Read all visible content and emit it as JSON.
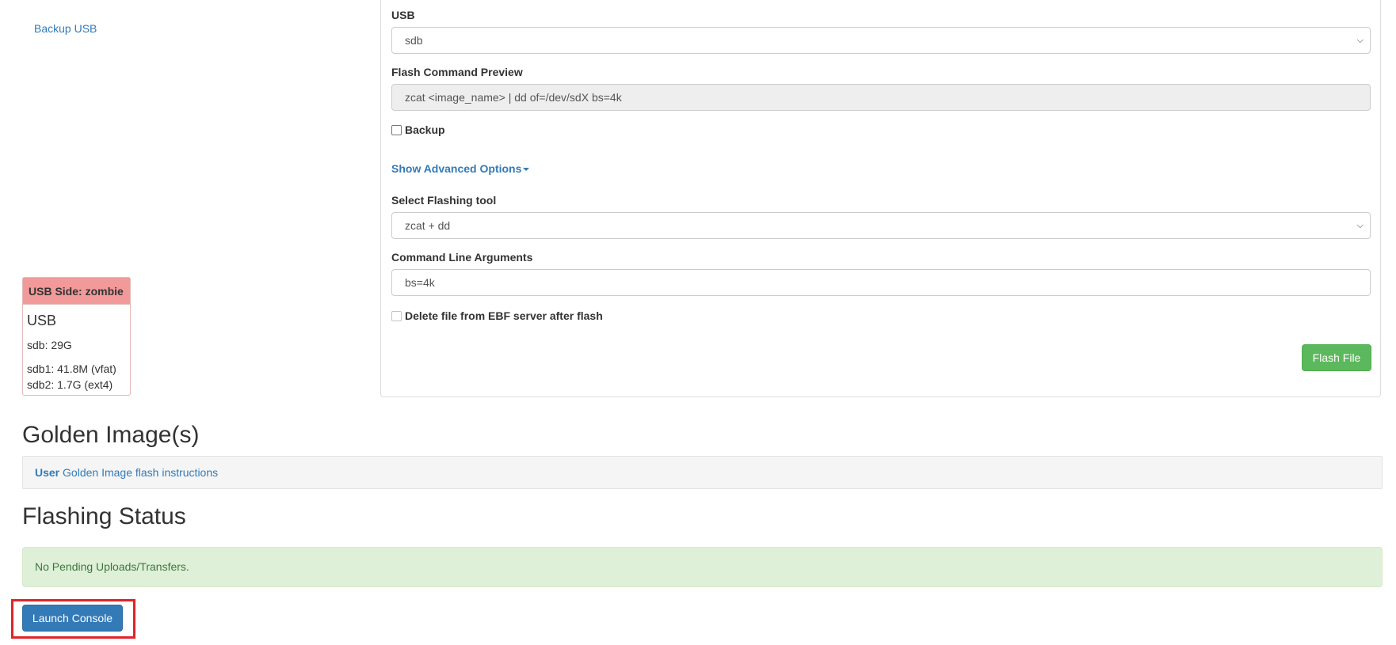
{
  "sidebar": {
    "backup_usb_link": "Backup USB"
  },
  "usb_card": {
    "header": "USB Side: zombie",
    "title": "USB",
    "device": "sdb: 29G",
    "partitions": [
      "sdb1: 41.8M (vfat)",
      "sdb2: 1.7G (ext4)"
    ]
  },
  "form": {
    "usb_label": "USB",
    "usb_selected": "sdb",
    "preview_label": "Flash Command Preview",
    "preview_value": "zcat <image_name> | dd of=/dev/sdX bs=4k",
    "backup_label": "Backup",
    "backup_checked": false,
    "advanced_toggle": "Show Advanced Options",
    "tool_label": "Select Flashing tool",
    "tool_selected": "zcat + dd",
    "args_label": "Command Line Arguments",
    "args_value": "bs=4k",
    "delete_label": "Delete file from EBF server after flash",
    "delete_checked": false,
    "delete_disabled": true,
    "flash_button": "Flash File"
  },
  "golden": {
    "heading": "Golden Image(s)",
    "user_label": "User",
    "instructions_link": "Golden Image flash instructions"
  },
  "status": {
    "heading": "Flashing Status",
    "message": "No Pending Uploads/Transfers."
  },
  "actions": {
    "launch_console": "Launch Console"
  },
  "colors": {
    "link": "#337ab7",
    "success_button": "#5cb85c",
    "primary_button": "#337ab7",
    "danger_header": "#f2999a",
    "alert_success_bg": "#dff0d8",
    "highlight_border": "#e0242a"
  }
}
